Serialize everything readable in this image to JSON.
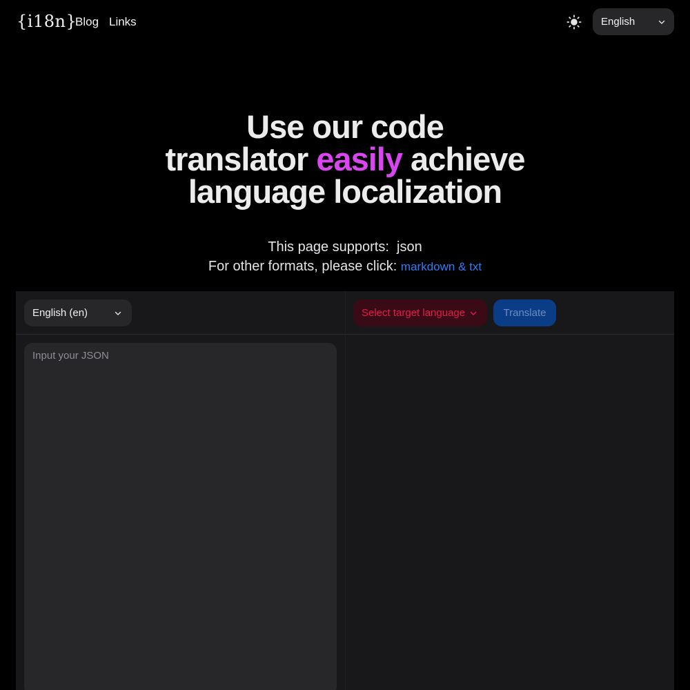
{
  "nav": {
    "logo": "{i18n}",
    "links": [
      {
        "label": "Blog"
      },
      {
        "label": "Links"
      }
    ],
    "language_selector": {
      "value": "English"
    }
  },
  "hero": {
    "title_part1": "Use our code",
    "title_part2": "translator ",
    "title_accent": "easily",
    "title_part3": " achieve",
    "title_part4": "language localization",
    "supports_label": "This page supports:",
    "supports_format": "json",
    "other_formats_label": "For other formats, please click:",
    "other_formats_link": "markdown & txt"
  },
  "workspace": {
    "source_language": "English (en)",
    "target_language_placeholder": "Select target language",
    "translate_label": "Translate",
    "input_placeholder": "Input your JSON"
  },
  "colors": {
    "background": "#000000",
    "panel": "#18181b",
    "field": "#27272a",
    "accent": "#d946ef",
    "link": "#2f7df6",
    "target_select_text": "#e11d48",
    "translate_button": "#0b3d86"
  },
  "icons": {
    "theme_toggle": "sun-icon",
    "dropdown": "chevron-down-icon"
  }
}
